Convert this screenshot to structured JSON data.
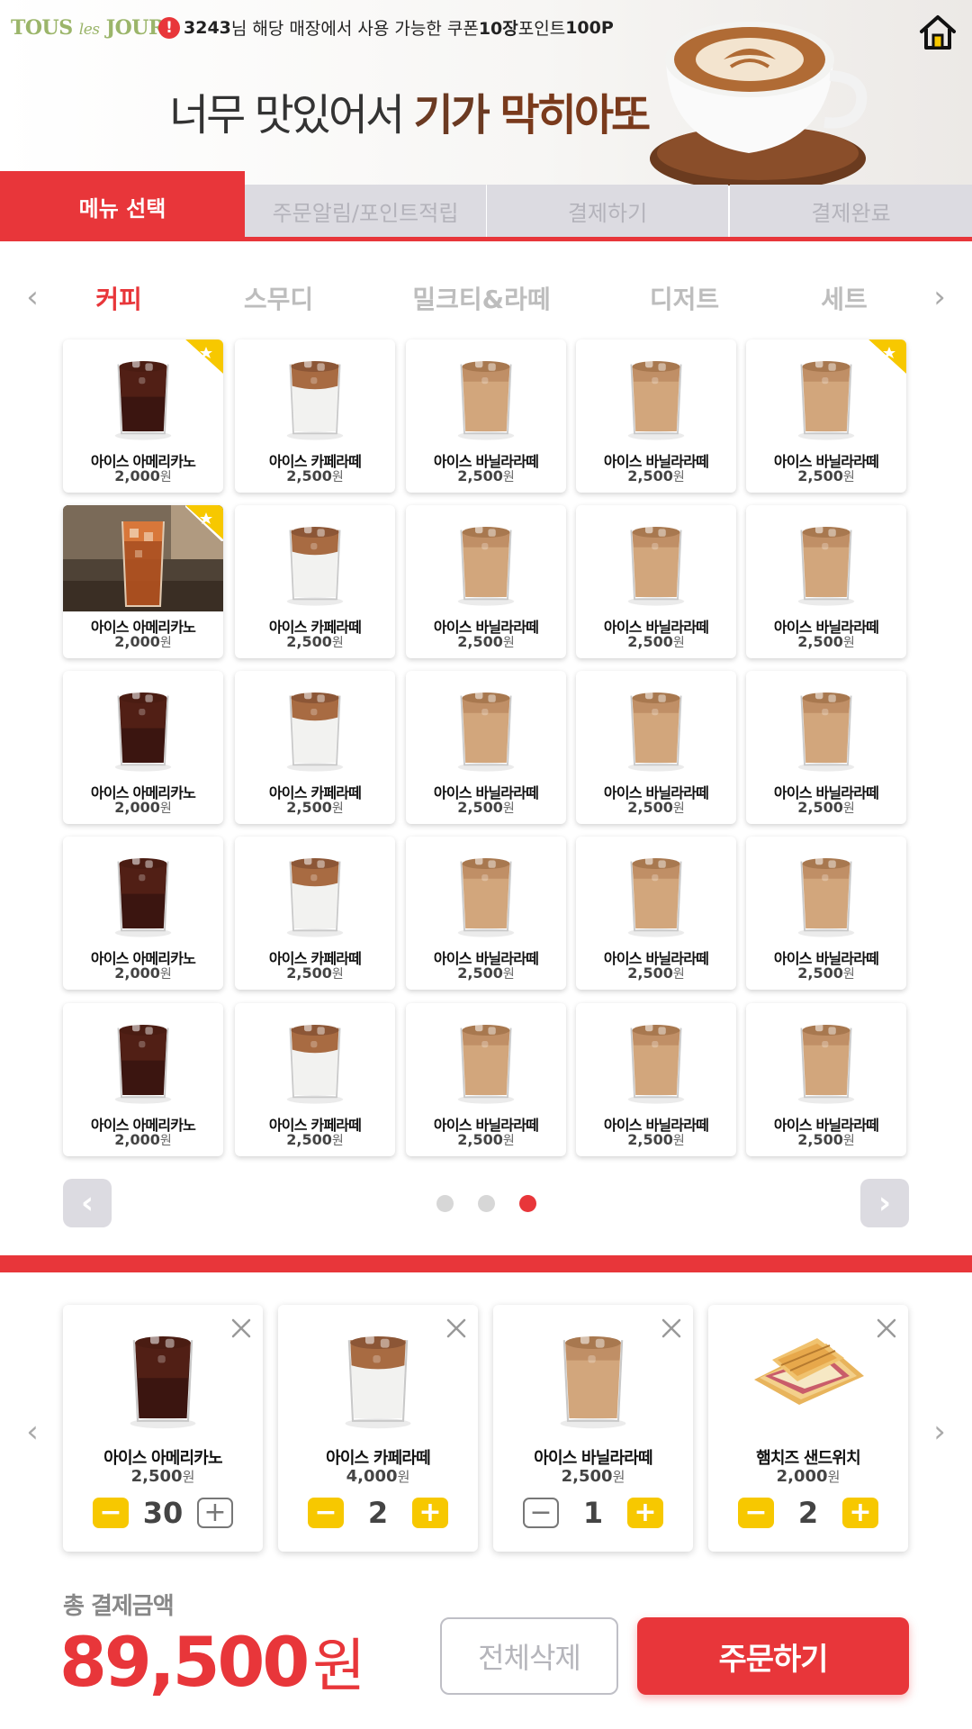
{
  "header": {
    "logo_main1": "TOUS",
    "logo_les": "les",
    "logo_main2": "JOURS",
    "notice": {
      "user": "3243",
      "text1": "님 해당 매장에서 사용 가능한 쿠폰 ",
      "coupons": "10장",
      "text2": " 포인트 ",
      "points": "100P"
    },
    "banner_plain": "너무 맛있어서 ",
    "banner_accent1": "기가 ",
    "banner_accent2": "막히아또"
  },
  "steps": [
    {
      "label": "메뉴 선택",
      "active": true
    },
    {
      "label": "주문알림/포인트적립",
      "active": false
    },
    {
      "label": "결제하기",
      "active": false
    },
    {
      "label": "결제완료",
      "active": false
    }
  ],
  "categories": [
    {
      "label": "커피",
      "active": true
    },
    {
      "label": "스무디",
      "active": false
    },
    {
      "label": "밀크티&라떼",
      "active": false
    },
    {
      "label": "디저트",
      "active": false
    },
    {
      "label": "세트",
      "active": false
    }
  ],
  "nav": {
    "left": "‹",
    "right": "›"
  },
  "products": {
    "row1": [
      {
        "name": "아이스 아메리카노",
        "price": "2,000",
        "won": "원",
        "img": "americano",
        "badge": true
      },
      {
        "name": "아이스 카페라떼",
        "price": "2,500",
        "won": "원",
        "img": "cafelatte",
        "badge": false
      },
      {
        "name": "아이스 바닐라라떼",
        "price": "2,500",
        "won": "원",
        "img": "vanilla",
        "badge": false
      },
      {
        "name": "아이스 바닐라라떼",
        "price": "2,500",
        "won": "원",
        "img": "vanilla",
        "badge": false
      },
      {
        "name": "아이스 바닐라라떼",
        "price": "2,500",
        "won": "원",
        "img": "vanilla",
        "badge": true
      }
    ],
    "row2": [
      {
        "name": "아이스 아메리카노",
        "price": "2,000",
        "won": "원",
        "img": "photo",
        "badge": true
      },
      {
        "name": "아이스 카페라떼",
        "price": "2,500",
        "won": "원",
        "img": "cafelatte",
        "badge": false
      },
      {
        "name": "아이스 바닐라라떼",
        "price": "2,500",
        "won": "원",
        "img": "vanilla",
        "badge": false
      },
      {
        "name": "아이스 바닐라라떼",
        "price": "2,500",
        "won": "원",
        "img": "vanilla",
        "badge": false
      },
      {
        "name": "아이스 바닐라라떼",
        "price": "2,500",
        "won": "원",
        "img": "vanilla",
        "badge": false
      }
    ],
    "row3": [
      {
        "name": "아이스 아메리카노",
        "price": "2,000",
        "won": "원",
        "img": "americano",
        "badge": false
      },
      {
        "name": "아이스 카페라떼",
        "price": "2,500",
        "won": "원",
        "img": "cafelatte",
        "badge": false
      },
      {
        "name": "아이스 바닐라라떼",
        "price": "2,500",
        "won": "원",
        "img": "vanilla",
        "badge": false
      },
      {
        "name": "아이스 바닐라라떼",
        "price": "2,500",
        "won": "원",
        "img": "vanilla",
        "badge": false
      },
      {
        "name": "아이스 바닐라라떼",
        "price": "2,500",
        "won": "원",
        "img": "vanilla",
        "badge": false
      }
    ],
    "row4": [
      {
        "name": "아이스 아메리카노",
        "price": "2,000",
        "won": "원",
        "img": "americano",
        "badge": false
      },
      {
        "name": "아이스 카페라떼",
        "price": "2,500",
        "won": "원",
        "img": "cafelatte",
        "badge": false
      },
      {
        "name": "아이스 바닐라라떼",
        "price": "2,500",
        "won": "원",
        "img": "vanilla",
        "badge": false
      },
      {
        "name": "아이스 바닐라라떼",
        "price": "2,500",
        "won": "원",
        "img": "vanilla",
        "badge": false
      },
      {
        "name": "아이스 바닐라라떼",
        "price": "2,500",
        "won": "원",
        "img": "vanilla",
        "badge": false
      }
    ],
    "row5": [
      {
        "name": "아이스 아메리카노",
        "price": "2,000",
        "won": "원",
        "img": "americano",
        "badge": false
      },
      {
        "name": "아이스 카페라떼",
        "price": "2,500",
        "won": "원",
        "img": "cafelatte",
        "badge": false
      },
      {
        "name": "아이스 바닐라라떼",
        "price": "2,500",
        "won": "원",
        "img": "vanilla",
        "badge": false
      },
      {
        "name": "아이스 바닐라라떼",
        "price": "2,500",
        "won": "원",
        "img": "vanilla",
        "badge": false
      },
      {
        "name": "아이스 바닐라라떼",
        "price": "2,500",
        "won": "원",
        "img": "vanilla",
        "badge": false
      }
    ]
  },
  "pager": {
    "prev": "‹",
    "next": "›",
    "pages": 3,
    "current": 3
  },
  "cart": [
    {
      "name": "아이스 아메리카노",
      "price": "2,500",
      "won": "원",
      "qty": "30",
      "img": "americano",
      "minus_active": true,
      "plus_active": false
    },
    {
      "name": "아이스 카페라떼",
      "price": "4,000",
      "won": "원",
      "qty": "2",
      "img": "cafelatte",
      "minus_active": true,
      "plus_active": true
    },
    {
      "name": "아이스 바닐라라떼",
      "price": "2,500",
      "won": "원",
      "qty": "1",
      "img": "vanilla",
      "minus_active": false,
      "plus_active": true
    },
    {
      "name": "햄치즈 샌드위치",
      "price": "2,000",
      "won": "원",
      "qty": "2",
      "img": "sandwich",
      "minus_active": true,
      "plus_active": true
    }
  ],
  "total": {
    "label": "총 결제금액",
    "amount": "89,500",
    "unit": "원"
  },
  "buttons": {
    "clear": "전체삭제",
    "order": "주문하기"
  },
  "colors": {
    "accent": "#e8363a",
    "yellow": "#f7c800",
    "inactive_tab": "#dcdbe1",
    "logo_green": "#9bb56a"
  },
  "icons": {
    "notice": "exclamation-circle-icon",
    "home": "home-icon",
    "badge": "star-badge-icon",
    "close": "close-icon",
    "minus": "minus-icon",
    "plus": "plus-icon"
  }
}
